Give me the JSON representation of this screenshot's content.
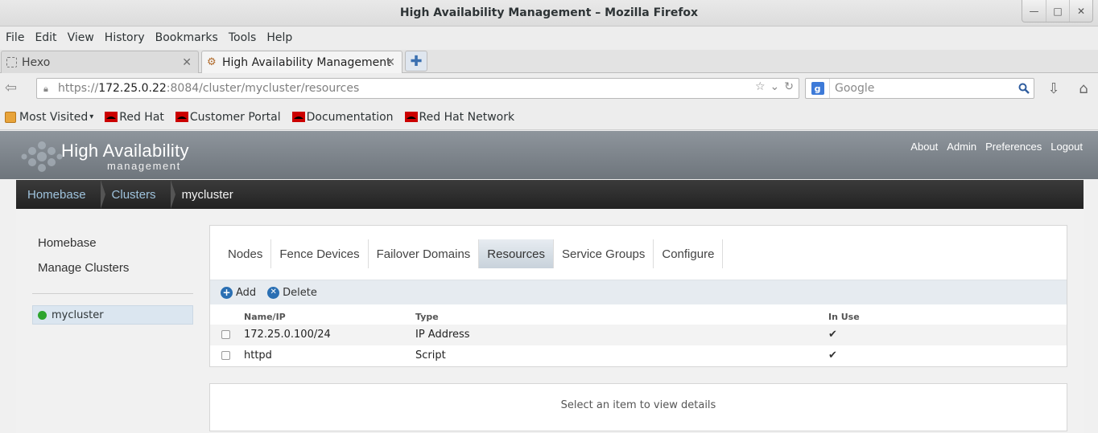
{
  "window": {
    "title": "High Availability Management – Mozilla Firefox",
    "controls": [
      "minimize",
      "maximize",
      "close"
    ]
  },
  "menubar": [
    "File",
    "Edit",
    "View",
    "History",
    "Bookmarks",
    "Tools",
    "Help"
  ],
  "tabs": [
    {
      "label": "Hexo",
      "active": false
    },
    {
      "label": "High Availability Management",
      "active": true
    }
  ],
  "urlbar": {
    "scheme": "https://",
    "host": "172.25.0.22",
    "rest": ":8084/cluster/mycluster/resources"
  },
  "search": {
    "placeholder": "Google",
    "engine_letter": "g"
  },
  "bookmarks": [
    "Most Visited",
    "Red Hat",
    "Customer Portal",
    "Documentation",
    "Red Hat Network"
  ],
  "app": {
    "brand": "High Availability",
    "brand_sub": "management",
    "toplinks": [
      "About",
      "Admin",
      "Preferences",
      "Logout"
    ],
    "breadcrumb": [
      "Homebase",
      "Clusters",
      "mycluster"
    ],
    "sidenav": {
      "links": [
        "Homebase",
        "Manage Clusters"
      ],
      "cluster": "mycluster"
    },
    "tabs": [
      "Nodes",
      "Fence Devices",
      "Failover Domains",
      "Resources",
      "Service Groups",
      "Configure"
    ],
    "active_tab": "Resources",
    "toolbar": {
      "add": "Add",
      "delete": "Delete"
    },
    "table": {
      "headers": [
        "Name/IP",
        "Type",
        "In Use"
      ],
      "rows": [
        {
          "name": "172.25.0.100/24",
          "type": "IP Address",
          "in_use": "✔"
        },
        {
          "name": "httpd",
          "type": "Script",
          "in_use": "✔"
        }
      ]
    },
    "details_message": "Select an item to view details"
  },
  "colors": {
    "accent": "#2a6fb3",
    "status_ok": "#2ea52e",
    "header": "#7e858c",
    "breadcrumb_bg": "#2b2b2b"
  }
}
